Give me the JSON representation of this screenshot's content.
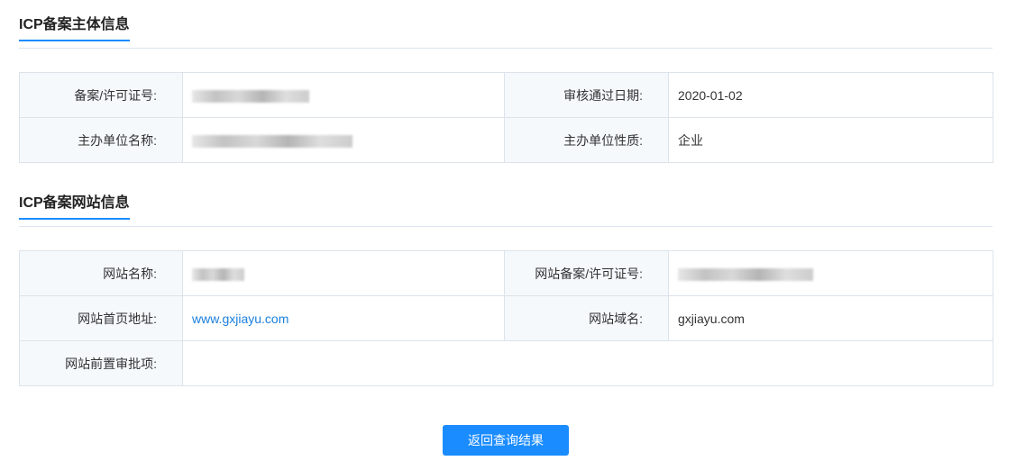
{
  "subject_section": {
    "title": "ICP备案主体信息",
    "rows": [
      {
        "label1": "备案/许可证号:",
        "label2": "审核通过日期:",
        "value2": "2020-01-02"
      },
      {
        "label1": "主办单位名称:",
        "label2": "主办单位性质:",
        "value2": "企业"
      }
    ]
  },
  "website_section": {
    "title": "ICP备案网站信息",
    "site_name_label": "网站名称:",
    "site_license_label": "网站备案/许可证号:",
    "home_url_label": "网站首页地址:",
    "home_url_value": "www.gxjiayu.com",
    "domain_label": "网站域名:",
    "domain_value": "gxjiayu.com",
    "pre_approval_label": "网站前置审批项:",
    "pre_approval_value": ""
  },
  "back_button_label": "返回查询结果",
  "colors": {
    "accent": "#1a8cff",
    "link": "#1a7fdc",
    "label_bg": "#f5f9fc",
    "border": "#dce3ea"
  }
}
